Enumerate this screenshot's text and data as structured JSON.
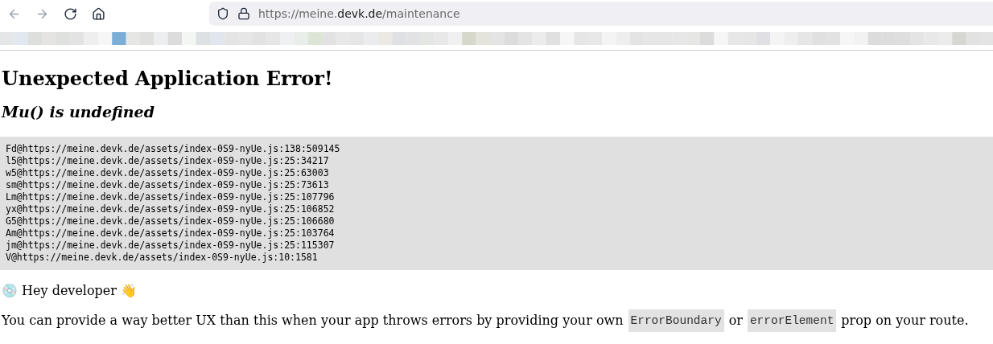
{
  "browser": {
    "url": {
      "prefix": "https://meine.",
      "domain": "devk.de",
      "path": "/maintenance"
    }
  },
  "error": {
    "title": "Unexpected Application Error!",
    "message": "Mu() is undefined",
    "stack": [
      "Fd@https://meine.devk.de/assets/index-0S9-nyUe.js:138:509145",
      "l5@https://meine.devk.de/assets/index-0S9-nyUe.js:25:34217",
      "w5@https://meine.devk.de/assets/index-0S9-nyUe.js:25:63003",
      "sm@https://meine.devk.de/assets/index-0S9-nyUe.js:25:73613",
      "Lm@https://meine.devk.de/assets/index-0S9-nyUe.js:25:107796",
      "yx@https://meine.devk.de/assets/index-0S9-nyUe.js:25:106852",
      "G5@https://meine.devk.de/assets/index-0S9-nyUe.js:25:106680",
      "Am@https://meine.devk.de/assets/index-0S9-nyUe.js:25:103764",
      "jm@https://meine.devk.de/assets/index-0S9-nyUe.js:25:115307",
      "V@https://meine.devk.de/assets/index-0S9-nyUe.js:10:1581"
    ]
  },
  "hint": {
    "greeting": "💿 Hey developer 👋",
    "parts": [
      {
        "kind": "text",
        "text": "You can provide a way better UX than this when your app throws errors by providing your own"
      },
      {
        "kind": "code",
        "text": "ErrorBoundary"
      },
      {
        "kind": "text",
        "text": "or"
      },
      {
        "kind": "code",
        "text": "errorElement"
      },
      {
        "kind": "text",
        "text": "prop on your route."
      }
    ]
  }
}
